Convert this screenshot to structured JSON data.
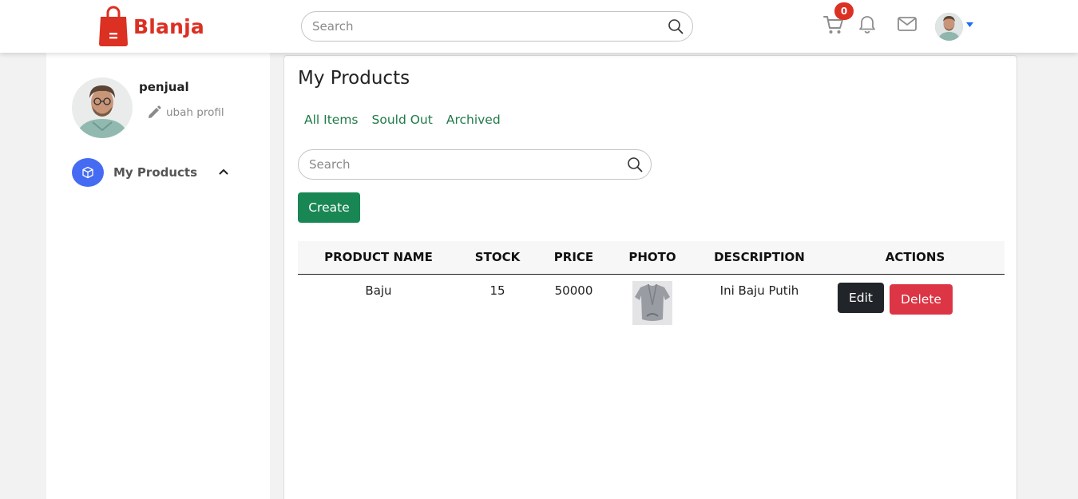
{
  "brand": {
    "name": "Blanja",
    "color": "#db3022"
  },
  "header": {
    "search_placeholder": "Search",
    "cart_count": "0",
    "icons": [
      "cart-icon",
      "bell-icon",
      "mail-icon",
      "avatar",
      "caret-down-icon"
    ]
  },
  "sidebar": {
    "username": "penjual",
    "edit_profile_label": "ubah profil",
    "menu_item_label": "My Products",
    "menu_icon": "box-icon",
    "accent": "#456bf3"
  },
  "main": {
    "title": "My Products",
    "tabs": [
      "All Items",
      "Sould Out",
      "Archived"
    ],
    "search_placeholder": "Search",
    "create_label": "Create",
    "table": {
      "headers": [
        "PRODUCT NAME",
        "STOCK",
        "PRICE",
        "PHOTO",
        "DESCRIPTION",
        "ACTIONS"
      ],
      "rows": [
        {
          "name": "Baju",
          "stock": "15",
          "price": "50000",
          "photo": "shirt-photo",
          "description": "Ini Baju Putih"
        }
      ],
      "edit_label": "Edit",
      "delete_label": "Delete"
    }
  },
  "colors": {
    "create": "#198754",
    "delete": "#dc3545",
    "edit": "#212529",
    "tab": "#1f7a47"
  }
}
